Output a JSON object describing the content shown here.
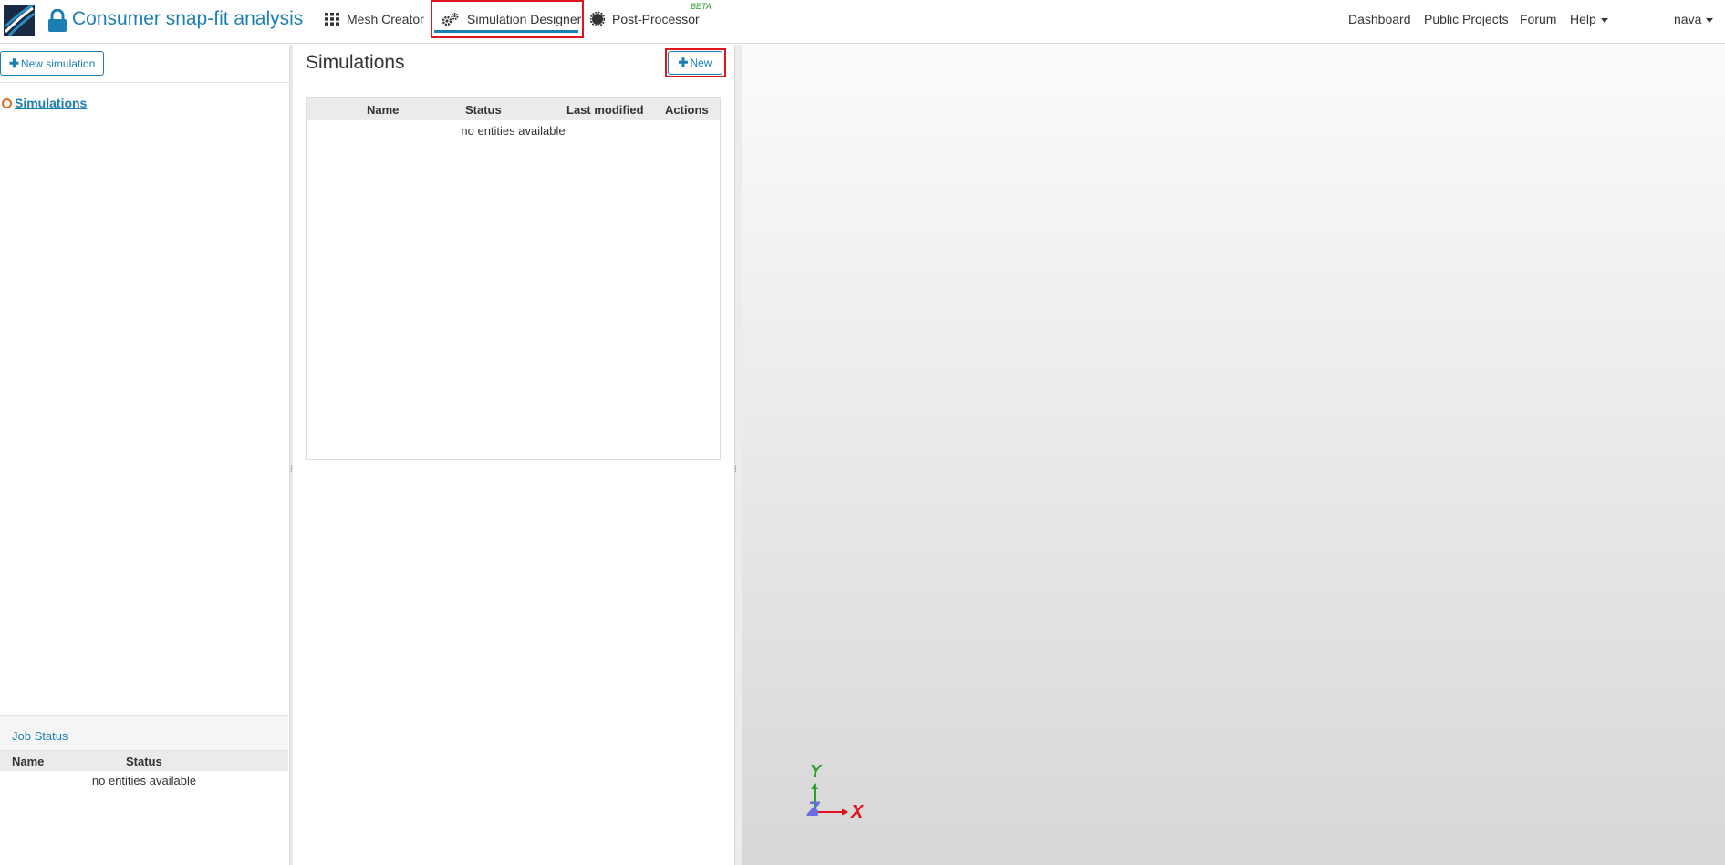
{
  "header": {
    "project_title": "Consumer snap-fit analysis",
    "tabs": [
      {
        "label": "Mesh Creator",
        "icon": "grid-icon"
      },
      {
        "label": "Simulation Designer",
        "icon": "gears-icon",
        "active": true
      },
      {
        "label": "Post-Processor",
        "icon": "gear-icon",
        "badge": "BETA"
      }
    ],
    "right_links": [
      "Dashboard",
      "Public Projects",
      "Forum",
      "Help"
    ],
    "user": "nava"
  },
  "left_panel": {
    "new_simulation_label": "New simulation",
    "tree_root": "Simulations",
    "job_status": {
      "title": "Job Status",
      "columns": [
        "Name",
        "Status"
      ],
      "empty_text": "no entities available"
    }
  },
  "main": {
    "title": "Simulations",
    "new_label": "New",
    "table": {
      "columns": [
        "Name",
        "Status",
        "Last modified",
        "Actions"
      ],
      "empty_text": "no entities available"
    }
  },
  "viewport": {
    "axes": {
      "x": "X",
      "y": "Y",
      "z": "Z"
    }
  },
  "colors": {
    "accent": "#1b7fb3",
    "highlight": "#e0141e",
    "beta": "#2ca02c",
    "tree_dot": "#e66a1a"
  }
}
